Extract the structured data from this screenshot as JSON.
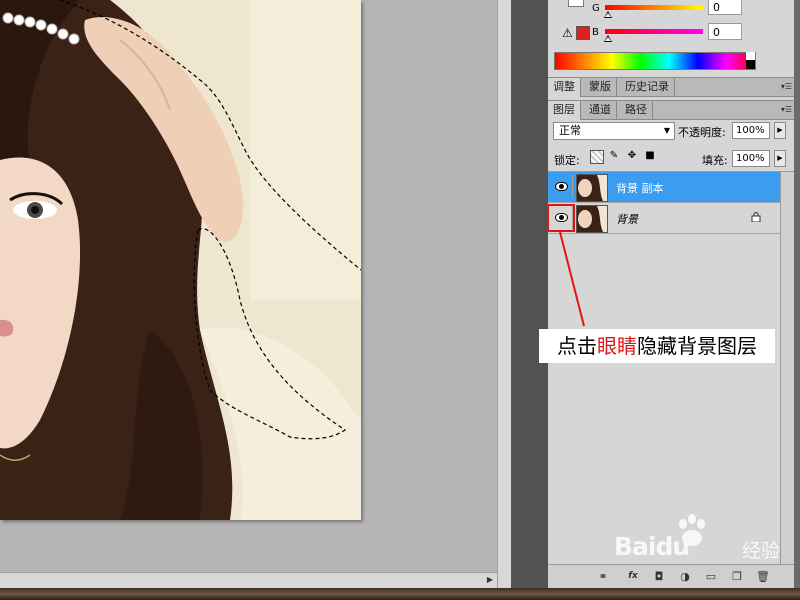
{
  "colors": {
    "accent_blue": "#3b9cf0",
    "annotation_red": "#e01515",
    "swatch_red": "#e02020"
  },
  "color_panel": {
    "g_label": "G",
    "g_value": "0",
    "b_label": "B",
    "b_value": "0",
    "warning_icon": "warning-triangle-icon"
  },
  "adjust_tabs": [
    "调整",
    "蒙版",
    "历史记录"
  ],
  "layer_tabs": [
    "图层",
    "通道",
    "路径"
  ],
  "layers_panel": {
    "blend_mode": "正常",
    "opacity_label": "不透明度:",
    "opacity_value": "100%",
    "lock_label": "锁定:",
    "fill_label": "填充:",
    "fill_value": "100%",
    "lock_icons": [
      "lock-transparent-icon",
      "lock-brush-icon",
      "lock-move-icon",
      "lock-all-icon"
    ]
  },
  "layers": [
    {
      "name": "背景 副本",
      "selected": true,
      "visible": true,
      "locked": false
    },
    {
      "name": "背景",
      "selected": false,
      "visible": true,
      "locked": true
    }
  ],
  "footer_icons": [
    "link-layers-icon",
    "fx-icon",
    "mask-icon",
    "adjustment-icon",
    "group-icon",
    "new-layer-icon",
    "trash-icon"
  ],
  "annotation": {
    "part1": "点击",
    "part2": "眼睛",
    "part3": "隐藏背景图层"
  },
  "watermark": {
    "text": "Baidu",
    "sub": "经验"
  }
}
